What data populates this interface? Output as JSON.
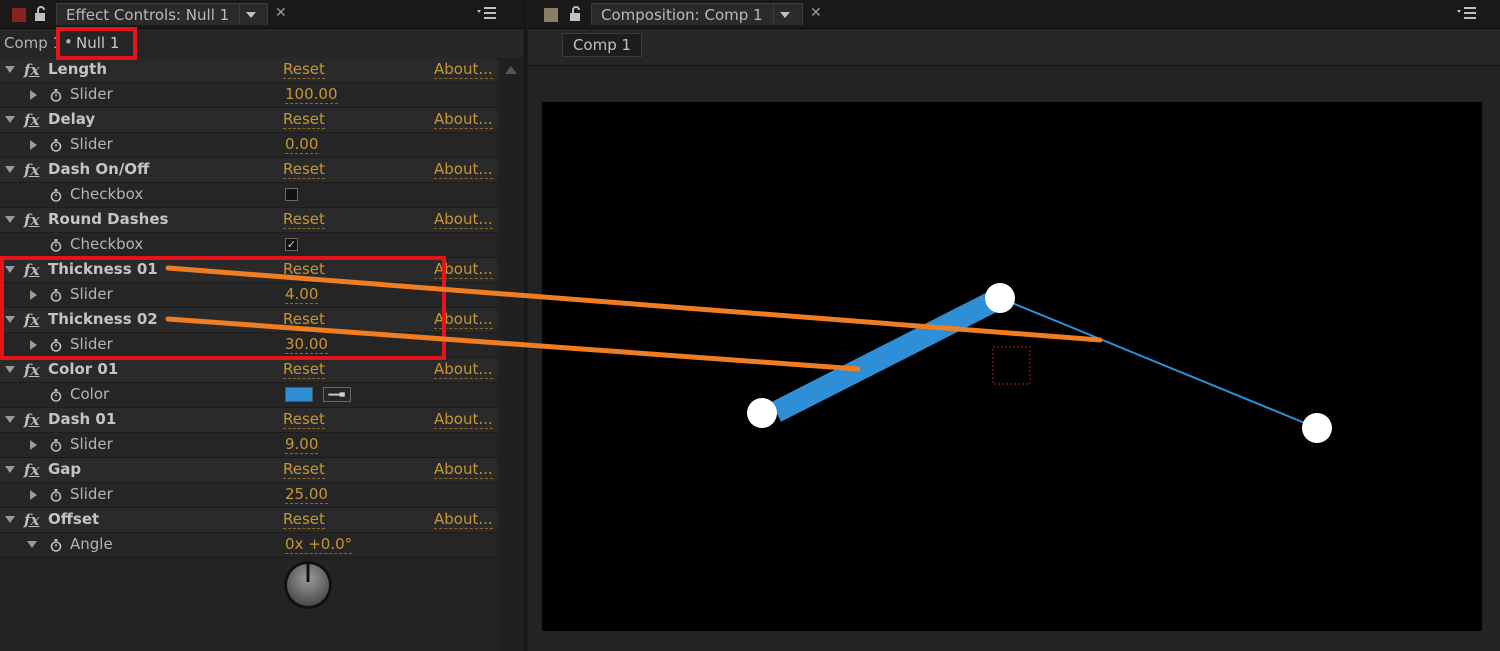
{
  "effect_controls": {
    "tab_title": "Effect Controls: Null 1",
    "breadcrumb_comp": "Comp 1",
    "breadcrumb_layer": "Null 1",
    "rows": [
      {
        "kind": "fx",
        "name": "Length",
        "reset": "Reset",
        "about": "About..."
      },
      {
        "kind": "prop",
        "name": "Slider",
        "value": "100.00",
        "control": "value"
      },
      {
        "kind": "fx",
        "name": "Delay",
        "reset": "Reset",
        "about": "About..."
      },
      {
        "kind": "prop",
        "name": "Slider",
        "value": "0.00",
        "control": "value"
      },
      {
        "kind": "fx",
        "name": "Dash On/Off",
        "reset": "Reset",
        "about": "About..."
      },
      {
        "kind": "prop",
        "name": "Checkbox",
        "control": "checkbox",
        "checked": false
      },
      {
        "kind": "fx",
        "name": "Round Dashes",
        "reset": "Reset",
        "about": "About..."
      },
      {
        "kind": "prop",
        "name": "Checkbox",
        "control": "checkbox",
        "checked": true
      },
      {
        "kind": "fx",
        "name": "Thickness 01",
        "reset": "Reset",
        "about": "About..."
      },
      {
        "kind": "prop",
        "name": "Slider",
        "value": "4.00",
        "control": "value"
      },
      {
        "kind": "fx",
        "name": "Thickness 02",
        "reset": "Reset",
        "about": "About..."
      },
      {
        "kind": "prop",
        "name": "Slider",
        "value": "30.00",
        "control": "value"
      },
      {
        "kind": "fx",
        "name": "Color 01",
        "reset": "Reset",
        "about": "About..."
      },
      {
        "kind": "prop",
        "name": "Color",
        "control": "color",
        "color": "#2f8fd6"
      },
      {
        "kind": "fx",
        "name": "Dash 01",
        "reset": "Reset",
        "about": "About..."
      },
      {
        "kind": "prop",
        "name": "Slider",
        "value": "9.00",
        "control": "value"
      },
      {
        "kind": "fx",
        "name": "Gap",
        "reset": "Reset",
        "about": "About..."
      },
      {
        "kind": "prop",
        "name": "Slider",
        "value": "25.00",
        "control": "value"
      },
      {
        "kind": "fx",
        "name": "Offset",
        "reset": "Reset",
        "about": "About..."
      },
      {
        "kind": "prop",
        "name": "Angle",
        "value": "0x +0.0°",
        "control": "value",
        "expanded": true
      }
    ]
  },
  "composition": {
    "tab_title": "Composition: Comp 1",
    "comp_tab": "Comp 1"
  },
  "colors": {
    "stroke": "#2f8fd6",
    "annotation_box": "#e3151b",
    "annotation_line": "#f07d22",
    "link": "#c89534"
  },
  "icons": [
    "stopwatch-icon",
    "lock-icon",
    "panel-menu-icon",
    "fx-icon",
    "eyedropper-icon",
    "close-icon"
  ]
}
